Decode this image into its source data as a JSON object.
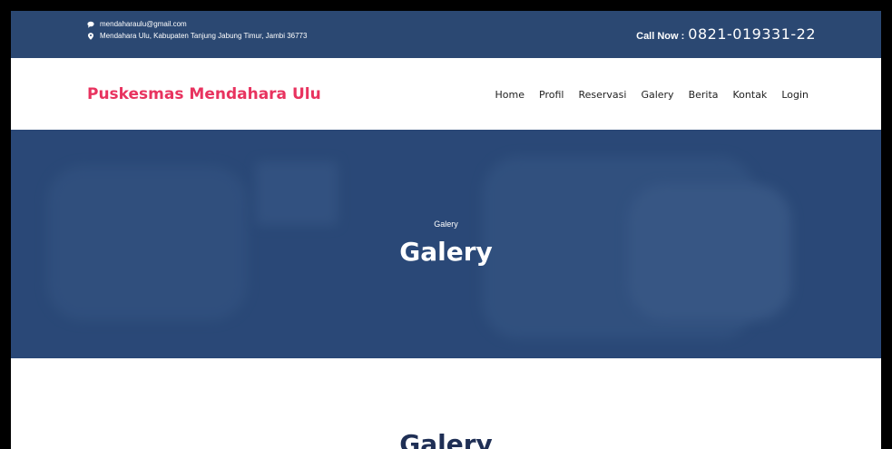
{
  "topbar": {
    "email": "mendaharaulu@gmail.com",
    "address": "Mendahara Ulu, Kabupaten Tanjung Jabung Timur, Jambi 36773",
    "call_label": "Call Now :",
    "phone": "0821-019331-22",
    "email_icon": "chat-bubble-icon",
    "address_icon": "map-pin-icon"
  },
  "navbar": {
    "brand": "Puskesmas Mendahara Ulu",
    "brand_color": "#e8335f",
    "items": [
      {
        "label": "Home"
      },
      {
        "label": "Profil"
      },
      {
        "label": "Reservasi"
      },
      {
        "label": "Galery"
      },
      {
        "label": "Berita"
      },
      {
        "label": "Kontak"
      },
      {
        "label": "Login"
      }
    ]
  },
  "hero": {
    "breadcrumb": "Galery",
    "title": "Galery"
  },
  "section": {
    "title": "Galery"
  },
  "colors": {
    "topbar_bg": "#2b4872",
    "hero_bg": "#2d4d7c",
    "heading": "#1f2f55"
  }
}
